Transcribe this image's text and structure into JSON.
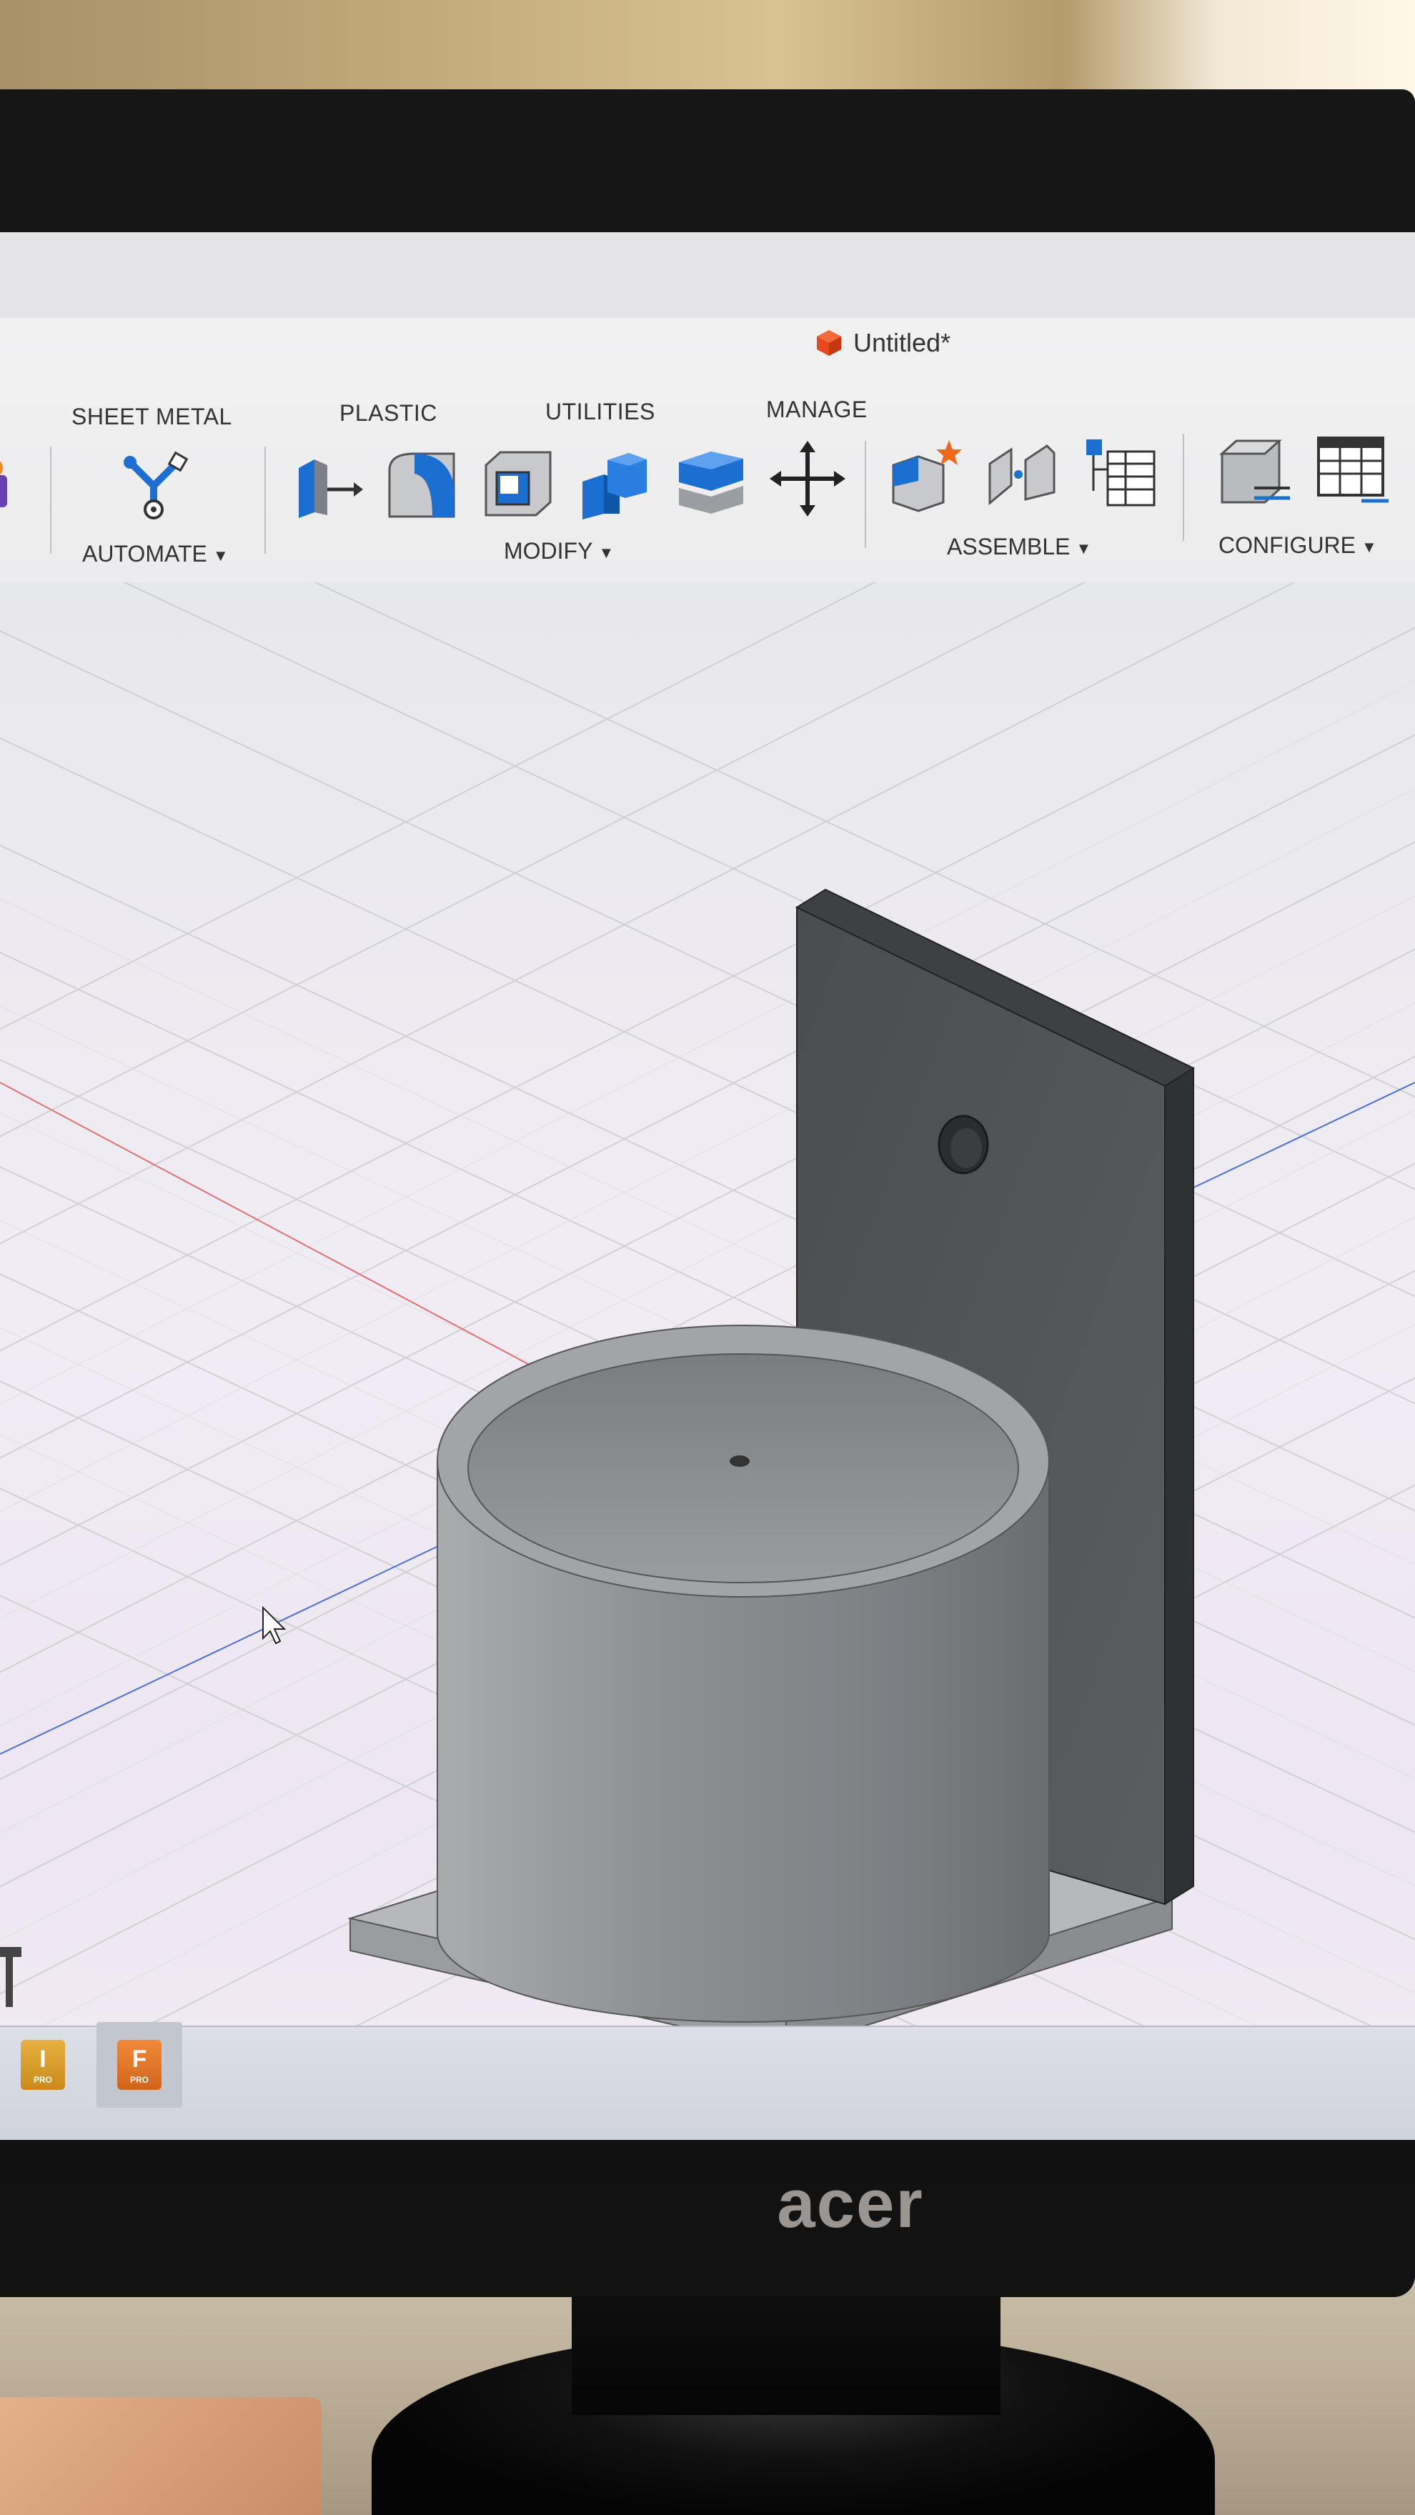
{
  "window": {
    "document_title": "Untitled*"
  },
  "toolbar": {
    "tabs": [
      "SHEET METAL",
      "PLASTIC",
      "UTILITIES",
      "MANAGE"
    ],
    "groups": {
      "automate": "AUTOMATE",
      "modify": "MODIFY",
      "assemble": "ASSEMBLE",
      "configure": "CONFIGURE"
    }
  },
  "taskbar": {
    "apps": [
      {
        "letter": "I",
        "badge": "PRO"
      },
      {
        "letter": "F",
        "badge": "PRO"
      }
    ]
  },
  "monitor": {
    "brand": "acer"
  },
  "colors": {
    "accent_blue": "#1b6fd1",
    "model_grey": "#8a8d90",
    "axis_red": "#e07070",
    "axis_blue": "#4a6fd8"
  }
}
